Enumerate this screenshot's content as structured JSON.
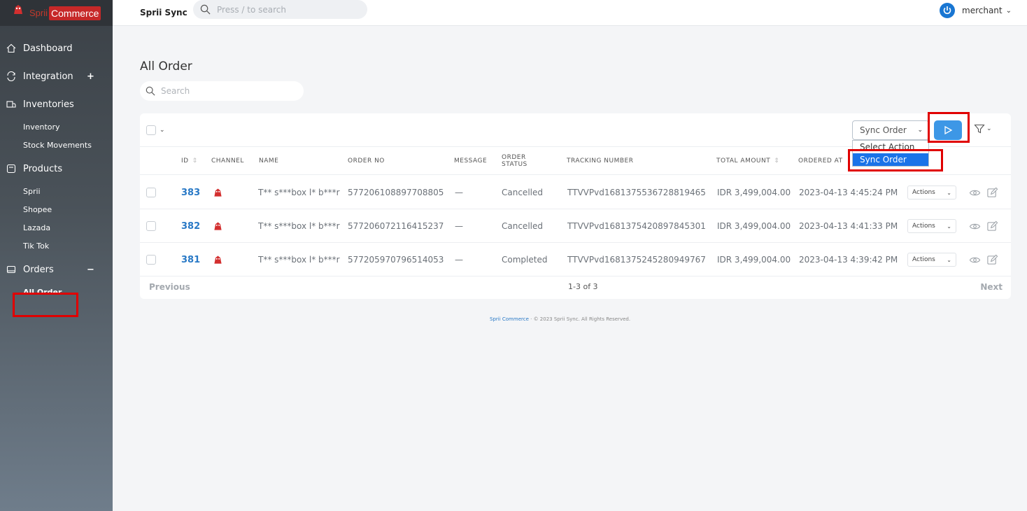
{
  "brand": {
    "name_part1": "Sprii",
    "name_part2": "Commerce"
  },
  "sidebar": {
    "items": [
      {
        "label": "Dashboard",
        "icon": "home-icon"
      },
      {
        "label": "Integration",
        "icon": "sync-icon",
        "mark": "+"
      },
      {
        "label": "Inventories",
        "icon": "box-icon"
      },
      {
        "label": "Products",
        "icon": "tag-icon"
      },
      {
        "label": "Orders",
        "icon": "cart-icon",
        "mark": "−"
      }
    ],
    "inventory_sub": [
      "Inventory",
      "Stock Movements"
    ],
    "products_sub": [
      "Sprii",
      "Shopee",
      "Lazada",
      "Tik Tok"
    ],
    "orders_sub": [
      "All Order"
    ]
  },
  "topbar": {
    "app_name": "Sprii Sync",
    "search_placeholder": "Press / to search",
    "user": "merchant"
  },
  "main": {
    "title": "All Order",
    "search_placeholder": "Search",
    "action_select": {
      "value": "Sync Order",
      "options": [
        "Select Action",
        "Sync Order"
      ]
    },
    "columns": {
      "id": "ID",
      "channel": "CHANNEL",
      "name": "NAME",
      "order_no": "ORDER NO",
      "message": "MESSAGE",
      "order_status_1": "ORDER",
      "order_status_2": "STATUS",
      "tracking": "TRACKING NUMBER",
      "total": "TOTAL AMOUNT",
      "ordered_at": "ORDERED AT"
    },
    "rows": [
      {
        "id": "383",
        "name": "T** s***box l* b***r",
        "order_no": "577206108897708805",
        "message": "—",
        "status": "Cancelled",
        "tracking": "TTVVPvd1681375536728819465",
        "total": "IDR 3,499,004.00",
        "ordered_at": "2023-04-13 4:45:24 PM",
        "actions": "Actions"
      },
      {
        "id": "382",
        "name": "T** s***box l* b***r",
        "order_no": "577206072116415237",
        "message": "—",
        "status": "Cancelled",
        "tracking": "TTVVPvd1681375420897845301",
        "total": "IDR 3,499,004.00",
        "ordered_at": "2023-04-13 4:41:33 PM",
        "actions": "Actions"
      },
      {
        "id": "381",
        "name": "T** s***box l* b***r",
        "order_no": "577205970796514053",
        "message": "—",
        "status": "Completed",
        "tracking": "TTVVPvd1681375245280949767",
        "total": "IDR 3,499,004.00",
        "ordered_at": "2023-04-13 4:39:42 PM",
        "actions": "Actions"
      }
    ],
    "pager": {
      "prev": "Previous",
      "info": "1-3 of 3",
      "next": "Next"
    }
  },
  "footer": {
    "brand": "Sprii Commerce",
    "separator": "·",
    "copyright": "© 2023 Sprii Sync. All Rights Reserved."
  },
  "colors": {
    "accent": "#3d97e6",
    "highlight": "#e00000",
    "brand_red": "#c62828"
  }
}
